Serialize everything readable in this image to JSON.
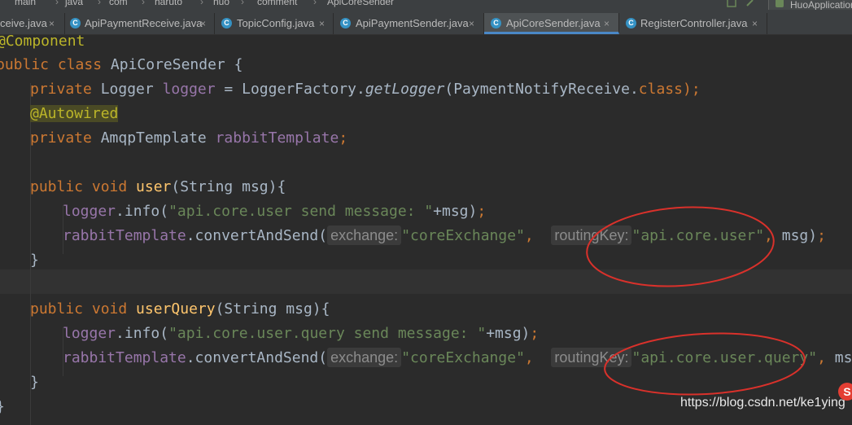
{
  "breadcrumb": [
    "main",
    "java",
    "com",
    "haruto",
    "huo",
    "comment",
    "ApiCoreSender"
  ],
  "run_config": "HuoApplication",
  "tabs": [
    {
      "label": "ceive.java",
      "active": false
    },
    {
      "label": "ApiPaymentReceive.java",
      "active": false
    },
    {
      "label": "TopicConfig.java",
      "active": false
    },
    {
      "label": "ApiPaymentSender.java",
      "active": false
    },
    {
      "label": "ApiCoreSender.java",
      "active": true
    },
    {
      "label": "RegisterController.java",
      "active": false
    }
  ],
  "tab_icon": "C",
  "close_glyph": "×",
  "code": {
    "l1": {
      "ann": "@Component"
    },
    "l2": {
      "kw": "public class ",
      "name": "ApiCoreSender ",
      "brace": "{"
    },
    "l3": {
      "kw": "private ",
      "type": "Logger ",
      "field": "logger",
      "eq": " = LoggerFactory.",
      "method": "getLogger",
      "arg": "(PaymentNotifyReceive.",
      "cls": "class",
      "end": ");"
    },
    "l4": {
      "ann": "@Autowired"
    },
    "l5": {
      "kw": "private ",
      "type": "AmqpTemplate ",
      "field": "rabbitTemplate",
      "end": ";"
    },
    "l7": {
      "kw": "public void ",
      "name": "user",
      "args": "(String msg){"
    },
    "l8": {
      "field": "logger",
      "call": ".info(",
      "str": "\"api.core.user send message: \"",
      "rest": "+msg)",
      "end": ";"
    },
    "l9": {
      "field": "rabbitTemplate",
      "call": ".convertAndSend(",
      "hint1": "exchange:",
      "str1": "\"coreExchange\"",
      "comma1": ",  ",
      "hint2": "routingKey:",
      "str2": "\"api.core.user\"",
      "comma2": ", ",
      "rest": "msg)",
      "end": ";"
    },
    "l10": {
      "brace": "}"
    },
    "l12": {
      "kw": "public void ",
      "name": "userQuery",
      "args": "(String msg){"
    },
    "l13": {
      "field": "logger",
      "call": ".info(",
      "str": "\"api.core.user.query send message: \"",
      "rest": "+msg)",
      "end": ";"
    },
    "l14": {
      "field": "rabbitTemplate",
      "call": ".convertAndSend(",
      "hint1": "exchange:",
      "str1": "\"coreExchange\"",
      "comma1": ",  ",
      "hint2": "routingKey:",
      "str2": "\"api.core.user.query\"",
      "comma2": ", ",
      "rest": "msg)",
      "end": ";"
    },
    "l15": {
      "brace": "}"
    },
    "l16": {
      "brace": "}"
    }
  },
  "watermark": "https://blog.csdn.net/ke1ying",
  "annotation_color": "#d9312b",
  "logo_letter": "S"
}
